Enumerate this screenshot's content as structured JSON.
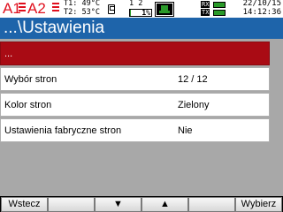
{
  "status_bar": {
    "alarm1": "A1",
    "alarm2": "A2",
    "temp1": "T1: 49°C",
    "temp2": "T2: 53°C",
    "channels": "1 2",
    "storage_usage": "1%",
    "storage_fraction": 0.01,
    "rx_label": "RX",
    "tx_label": "TX",
    "rx_active": true,
    "tx_active": true,
    "date": "22/10/15",
    "time": "14:12:36",
    "icons": [
      "sd-card-icon",
      "network-icon"
    ]
  },
  "title": "...\\Ustawienia",
  "menu": {
    "items": [
      {
        "label": "...",
        "value": "",
        "selected": true
      },
      {
        "label": "Wybór stron",
        "value": "12 / 12",
        "selected": false
      },
      {
        "label": "Kolor stron",
        "value": "Zielony",
        "selected": false
      },
      {
        "label": "Ustawienia fabryczne stron",
        "value": "Nie",
        "selected": false
      }
    ]
  },
  "softkeys": {
    "back": "Wstecz",
    "key2": "",
    "down": "▼",
    "up": "▲",
    "key5": "",
    "select": "Wybierz"
  },
  "colors": {
    "title_bar": "#1e64aa",
    "selected_row": "#a90b14",
    "alarm": "#e0101e",
    "background": "#a8a8a8",
    "usage_fill": "#2a9a2a"
  }
}
